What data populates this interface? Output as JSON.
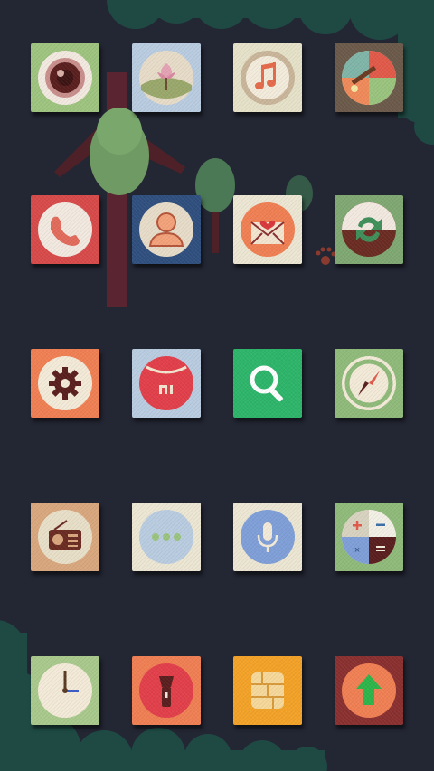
{
  "screen": {
    "background": "#232633"
  },
  "apps": [
    {
      "id": "camera",
      "icon": "camera-icon",
      "tile_color": "#9ec47f"
    },
    {
      "id": "gallery",
      "icon": "gallery-icon",
      "tile_color": "#b9cce0"
    },
    {
      "id": "music",
      "icon": "music-note-icon",
      "tile_color": "#e6e2c9"
    },
    {
      "id": "themes",
      "icon": "theme-palette-icon",
      "tile_color": "#6b5a4a"
    },
    {
      "id": "phone",
      "icon": "phone-icon",
      "tile_color": "#d84a4a"
    },
    {
      "id": "contacts",
      "icon": "contact-person-icon",
      "tile_color": "#2f4f7e"
    },
    {
      "id": "messages",
      "icon": "envelope-heart-icon",
      "tile_color": "#ece6d3"
    },
    {
      "id": "backup",
      "icon": "sync-arrows-icon",
      "tile_color": "#7fa872"
    },
    {
      "id": "settings",
      "icon": "gear-icon",
      "tile_color": "#f07f53"
    },
    {
      "id": "mi-market",
      "icon": "shopping-bag-icon",
      "tile_color": "#b9cce0"
    },
    {
      "id": "search",
      "icon": "magnifier-icon",
      "tile_color": "#2db56a"
    },
    {
      "id": "compass",
      "icon": "compass-icon",
      "tile_color": "#8fba7a"
    },
    {
      "id": "radio",
      "icon": "radio-icon",
      "tile_color": "#d9a77e"
    },
    {
      "id": "more",
      "icon": "three-dots-icon",
      "tile_color": "#ece6d3"
    },
    {
      "id": "voice-recorder",
      "icon": "microphone-icon",
      "tile_color": "#ece6d3"
    },
    {
      "id": "calculator",
      "icon": "calculator-icon",
      "tile_color": "#8fba7a"
    },
    {
      "id": "clock",
      "icon": "clock-icon",
      "tile_color": "#a9c98c"
    },
    {
      "id": "flashlight",
      "icon": "flashlight-icon",
      "tile_color": "#f07f53"
    },
    {
      "id": "sim-toolkit",
      "icon": "sim-card-icon",
      "tile_color": "#f3a227"
    },
    {
      "id": "updater",
      "icon": "upload-arrow-icon",
      "tile_color": "#8a2f2f"
    }
  ]
}
